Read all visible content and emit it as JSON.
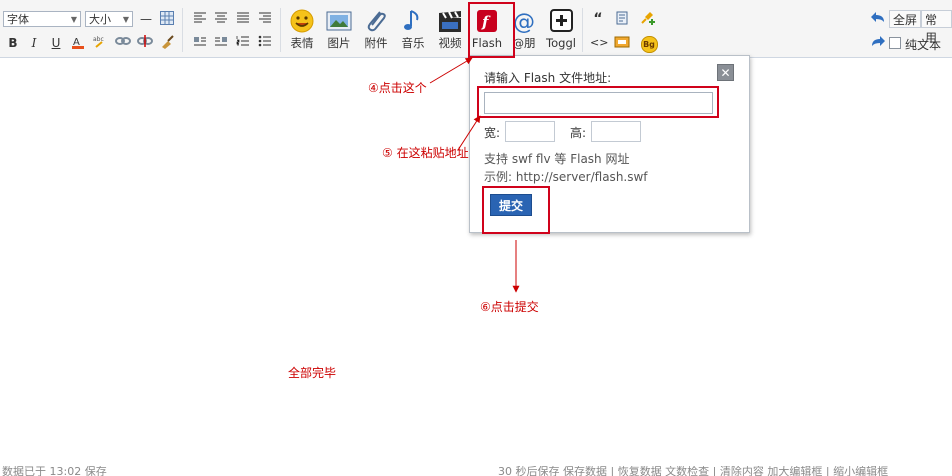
{
  "toolbar": {
    "font_select": "字体",
    "size_select": "大小",
    "big_buttons": [
      {
        "label": "表情",
        "icon": "smiley-icon"
      },
      {
        "label": "图片",
        "icon": "image-icon"
      },
      {
        "label": "附件",
        "icon": "paperclip-icon"
      },
      {
        "label": "音乐",
        "icon": "music-note-icon"
      },
      {
        "label": "视频",
        "icon": "clapperboard-icon"
      },
      {
        "label": "Flash",
        "icon": "flash-icon"
      },
      {
        "label": "@朋",
        "icon": "at-sign-icon"
      },
      {
        "label": "Toggl",
        "icon": "plus-box-icon"
      }
    ],
    "format_bold": "B",
    "format_italic": "I",
    "format_underline": "U",
    "quote_glyph": "“",
    "code_glyph": "<>",
    "bg_badge": "Bg",
    "fullscreen": "全屏",
    "common": "常用",
    "plain_text": "纯文本"
  },
  "dialog": {
    "title": "请输入 Flash 文件地址:",
    "close_glyph": "✕",
    "width_label": "宽:",
    "height_label": "高:",
    "hint1": "支持 swf flv 等 Flash 网址",
    "hint2": "示例: http://server/flash.swf",
    "submit": "提交"
  },
  "annotations": {
    "step4": "④点击这个",
    "step5": "⑤ 在这粘贴地址",
    "step6": "⑥点击提交",
    "done": "全部完毕"
  },
  "status": {
    "left": "数据已于 13:02 保存",
    "right": "30 秒后保存 保存数据 | 恢复数据 文数检查 | 清除内容 加大编辑框 | 缩小编辑框"
  },
  "colors": {
    "highlight": "#d0021b",
    "annotation": "#cc0000",
    "submit": "#2a64b3"
  }
}
